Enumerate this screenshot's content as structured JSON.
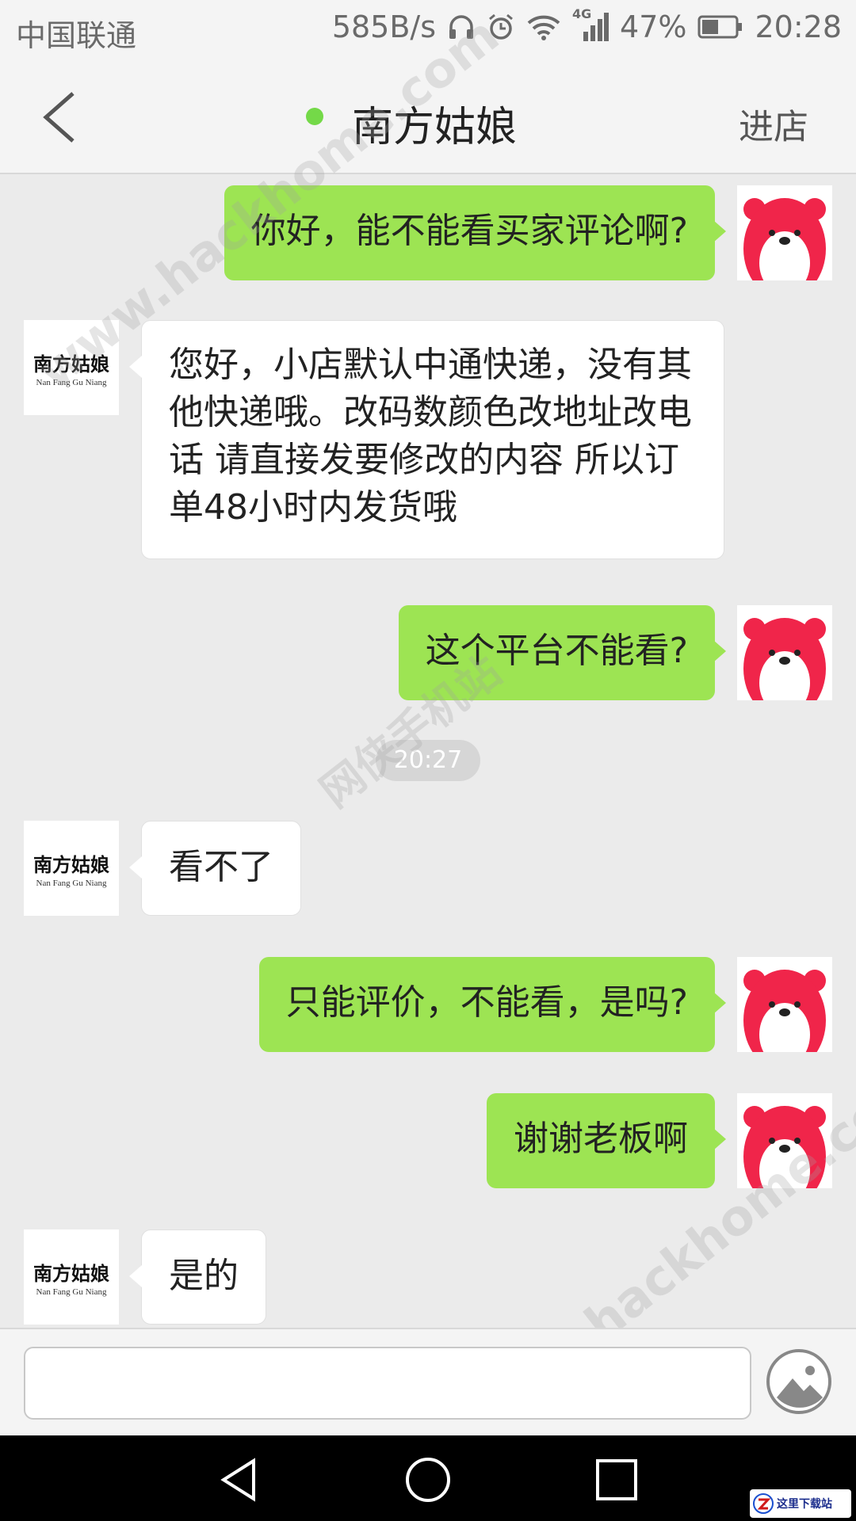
{
  "status_bar": {
    "carrier": "中国联通",
    "net_speed": "585B/s",
    "network_type": "4G",
    "battery": "47%",
    "time": "20:28"
  },
  "header": {
    "title": "南方姑娘",
    "enter_shop_label": "进店",
    "online_color": "#74d948"
  },
  "seller_avatar": {
    "name_cn": "南方姑娘",
    "name_en": "Nan Fang Gu Niang"
  },
  "messages": [
    {
      "side": "out",
      "text": "你好，能不能看买家评论啊?"
    },
    {
      "side": "in",
      "text": "您好，小店默认中通快递，没有其他快递哦。改码数颜色改地址改电话 请直接发要修改的内容 所以订单48小时内发货哦"
    },
    {
      "side": "out",
      "text": "这个平台不能看?"
    },
    {
      "side": "time",
      "text": "20:27"
    },
    {
      "side": "in",
      "text": "看不了"
    },
    {
      "side": "out",
      "text": "只能评价，不能看，是吗?"
    },
    {
      "side": "out",
      "text": "谢谢老板啊"
    },
    {
      "side": "in",
      "text": "是的"
    }
  ],
  "input": {
    "placeholder": ""
  },
  "colors": {
    "outgoing_bubble": "#9de453",
    "incoming_bubble": "#ffffff",
    "background": "#ebebeb"
  },
  "watermarks": [
    "www.hackhome.com",
    "网侠手机站",
    "www.hackhome.com"
  ],
  "watermark_badge": "这里下载站"
}
